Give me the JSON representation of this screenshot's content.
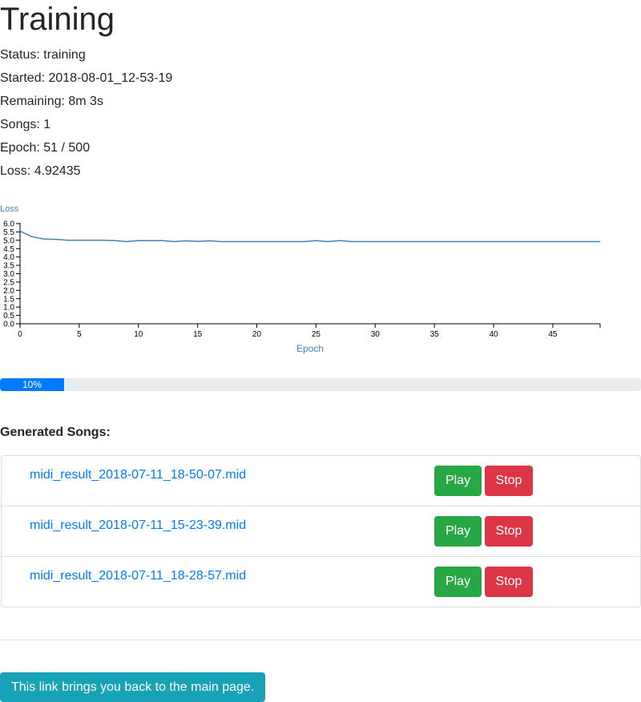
{
  "page": {
    "title": "Training"
  },
  "status": {
    "status": "Status: training",
    "started": "Started: 2018-08-01_12-53-19",
    "remaining": "Remaining: 8m 3s",
    "songs": "Songs: 1",
    "epoch": "Epoch: 51 / 500",
    "loss": "Loss: 4.92435"
  },
  "chart_data": {
    "type": "line",
    "title": "Loss",
    "xlabel": "Epoch",
    "ylabel": "",
    "xlim": [
      0,
      49
    ],
    "ylim": [
      0,
      6
    ],
    "xticks": [
      0,
      5,
      10,
      15,
      20,
      25,
      30,
      35,
      40,
      45
    ],
    "yticks": [
      "0.0",
      "0.5",
      "1.0",
      "1.5",
      "2.0",
      "2.5",
      "3.0",
      "3.5",
      "4.0",
      "4.5",
      "5.0",
      "5.5",
      "6.0"
    ],
    "grid": false,
    "color": "#4682b4",
    "series": [
      {
        "x": [
          0,
          1,
          2,
          3,
          4,
          5,
          6,
          7,
          8,
          9,
          10,
          11,
          12,
          13,
          14,
          15,
          16,
          17,
          18,
          19,
          20,
          21,
          22,
          23,
          24,
          25,
          26,
          27,
          28,
          29,
          30,
          31,
          32,
          33,
          34,
          35,
          36,
          37,
          38,
          39,
          40,
          41,
          42,
          43,
          44,
          45,
          46,
          47,
          48,
          49
        ],
        "values": [
          5.55,
          5.22,
          5.08,
          5.06,
          5.0,
          5.0,
          5.0,
          5.0,
          4.98,
          4.92,
          4.98,
          4.98,
          4.98,
          4.92,
          4.97,
          4.93,
          4.97,
          4.92,
          4.92,
          4.92,
          4.92,
          4.92,
          4.92,
          4.92,
          4.92,
          4.98,
          4.92,
          4.98,
          4.92,
          4.92,
          4.92,
          4.92,
          4.92,
          4.92,
          4.92,
          4.92,
          4.92,
          4.92,
          4.92,
          4.92,
          4.92,
          4.92,
          4.92,
          4.92,
          4.92,
          4.92,
          4.92,
          4.92,
          4.92,
          4.92
        ]
      }
    ]
  },
  "progress": {
    "value": 10,
    "label": "10%"
  },
  "songs": {
    "heading": "Generated Songs:",
    "play_label": "Play",
    "stop_label": "Stop",
    "items": [
      {
        "name": "midi_result_2018-07-11_18-50-07.mid"
      },
      {
        "name": "midi_result_2018-07-11_15-23-39.mid"
      },
      {
        "name": "midi_result_2018-07-11_18-28-57.mid"
      }
    ]
  },
  "footer": {
    "back_link": "This link brings you back to the main page."
  },
  "colors": {
    "primary": "#007bff",
    "success": "#28a745",
    "danger": "#dc3545",
    "info": "#17a2b8",
    "chart_line": "#4682b4"
  }
}
